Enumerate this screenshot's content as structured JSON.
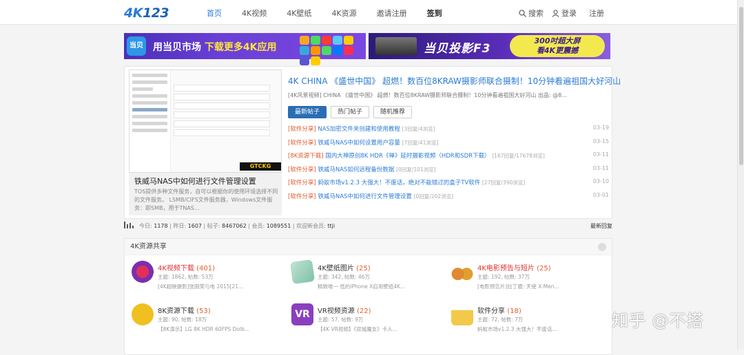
{
  "site": {
    "logo_a": "4K",
    "logo_b": "123"
  },
  "nav": [
    {
      "label": "首页"
    },
    {
      "label": "4K视频"
    },
    {
      "label": "4K壁纸"
    },
    {
      "label": "4K资源"
    },
    {
      "label": "邀请注册"
    },
    {
      "label": "签到"
    }
  ],
  "user": {
    "search": "搜索",
    "login": "登录",
    "register": "注册"
  },
  "banners": {
    "left": {
      "tag": "当贝",
      "text_a": "用当贝市场 ",
      "text_b": "下载更多4K应用"
    },
    "right": {
      "text": "当贝投影F3",
      "pill_a": "300吋超大屏",
      "pill_b": "看4K更震撼"
    }
  },
  "featured": {
    "thumb_brand": "GTCKG",
    "title": "铁威马NAS中如何进行文件管理设置",
    "desc": "TOS提供多种文件服务，自可以根据你的使用环境选择不同的文件服务。 LSMB/CIFS文件服务器，Windows文件服务：即SMB，用于TNAS..."
  },
  "headline": {
    "title": "4K CHINA 《盛世中国》 超燃！数百位8KRAW摄影师联合摄制！10分钟看遍祖国大好河山",
    "sub": "[4K风景视频] CHINA 《盛世中国》 超燃！数百位8KRAW摄影师联合摄制！10分钟看遍祖国大好河山 出品: @8..."
  },
  "tabs": [
    {
      "label": "最新帖子",
      "active": true
    },
    {
      "label": "热门帖子",
      "active": false
    },
    {
      "label": "随机推荐",
      "active": false
    }
  ],
  "threads": [
    {
      "cat": "[软件分享]",
      "title": "NAS加密文件夹创建和使用教程",
      "meta": "[3回复/4浏览]",
      "date": "03-19"
    },
    {
      "cat": "[软件分享]",
      "title": "铁威马NAS中如何设置用户容量",
      "meta": "[7回复/41浏览]",
      "date": "03-15"
    },
    {
      "cat": "[8K资源下载]",
      "title": "国内大神原创8K HDR《禅》延时摄影视频（HDR和SDR下载）",
      "meta": "[167回复/17678浏览]",
      "date": "03-11"
    },
    {
      "cat": "[软件分享]",
      "title": "铁威马NAS如何远程备份数据",
      "meta": "[0回复/101浏览]",
      "date": "03-11"
    },
    {
      "cat": "[软件分享]",
      "title": "蚂蚁市场v1.2.3 大强大！不废话，绝对不能错过的盒子TV软件",
      "meta": "[27回复/390浏览]",
      "date": "03-10"
    },
    {
      "cat": "[软件分享]",
      "title": "铁威马NAS中如何进行文件管理设置",
      "meta": "[0回复/202浏览]",
      "date": "03-01"
    }
  ],
  "stats": {
    "today_label": "今日:",
    "today": "1178",
    "yesterday_label": "昨日:",
    "yesterday": "1607",
    "posts_label": "帖子:",
    "posts": "8467062",
    "members_label": "会员:",
    "members": "1089551",
    "welcome_label": "欢迎新会员:",
    "newest": "ttji",
    "newest_link": "最新回复"
  },
  "forum": {
    "title": "4K资源共享",
    "cells": [
      {
        "name": "4K视频下载",
        "count": "(401)",
        "stats": "主题: 1862, 帖数: 53万",
        "last": "[4K超映摄影]张国荣与电 2015[21...",
        "red": true,
        "color": "#c0306a"
      },
      {
        "name": "4K壁纸图片",
        "count": "(25)",
        "stats": "主题: 342, 帖数: 46万",
        "last": "精致唯一 低的iPhone X启用壁纸4K...",
        "red": false,
        "color": "#7fc0a8"
      },
      {
        "name": "4K电影预告与短片",
        "count": "(25)",
        "stats": "主题: 192, 帖数: 37万",
        "last": "[电影预告片]拉丁鹿: 天使 X-Men...",
        "red": true,
        "color": "#e08a30"
      },
      {
        "name": "8K资源下载",
        "count": "(53)",
        "stats": "主题: 90, 帖数: 18万",
        "last": "【8K演示】LG 8K HDR 60FPS Dolb...",
        "red": false,
        "color": "#f0c020"
      },
      {
        "name": "VR视频资源",
        "count": "(22)",
        "stats": "主题: 57, 帖数: 9万",
        "last": "【4K VR视频】《双城魔女》卡人...",
        "red": false,
        "color": "#8a3fbf"
      },
      {
        "name": "软件分享",
        "count": "(18)",
        "stats": "主题: 72, 帖数: 7万",
        "last": "蚂蚁市场v1.2.3 大强大！不废话...",
        "red": false,
        "color": "#f3c94a"
      }
    ]
  },
  "watermark": "知乎 @不搭"
}
